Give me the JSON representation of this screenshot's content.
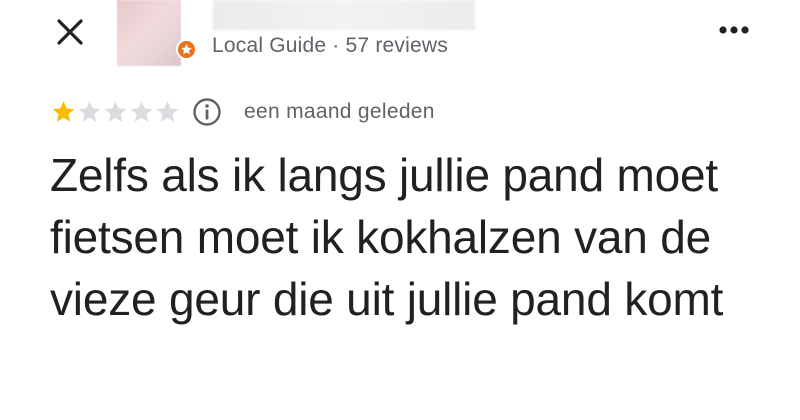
{
  "header": {
    "close_icon": "close-icon",
    "more_icon": "more-horizontal-icon"
  },
  "reviewer": {
    "avatar_badge_icon": "local-guide-star-icon",
    "meta": "Local Guide · 57 reviews"
  },
  "review": {
    "rating": 1,
    "max_rating": 5,
    "star_filled_color": "#fbbc04",
    "star_empty_color": "#dadce0",
    "info_icon": "info-icon",
    "date": "een maand geleden",
    "text": "Zelfs als ik langs jullie pand moet fietsen moet ik kokhalzen van de vieze geur die uit jullie pand komt"
  }
}
